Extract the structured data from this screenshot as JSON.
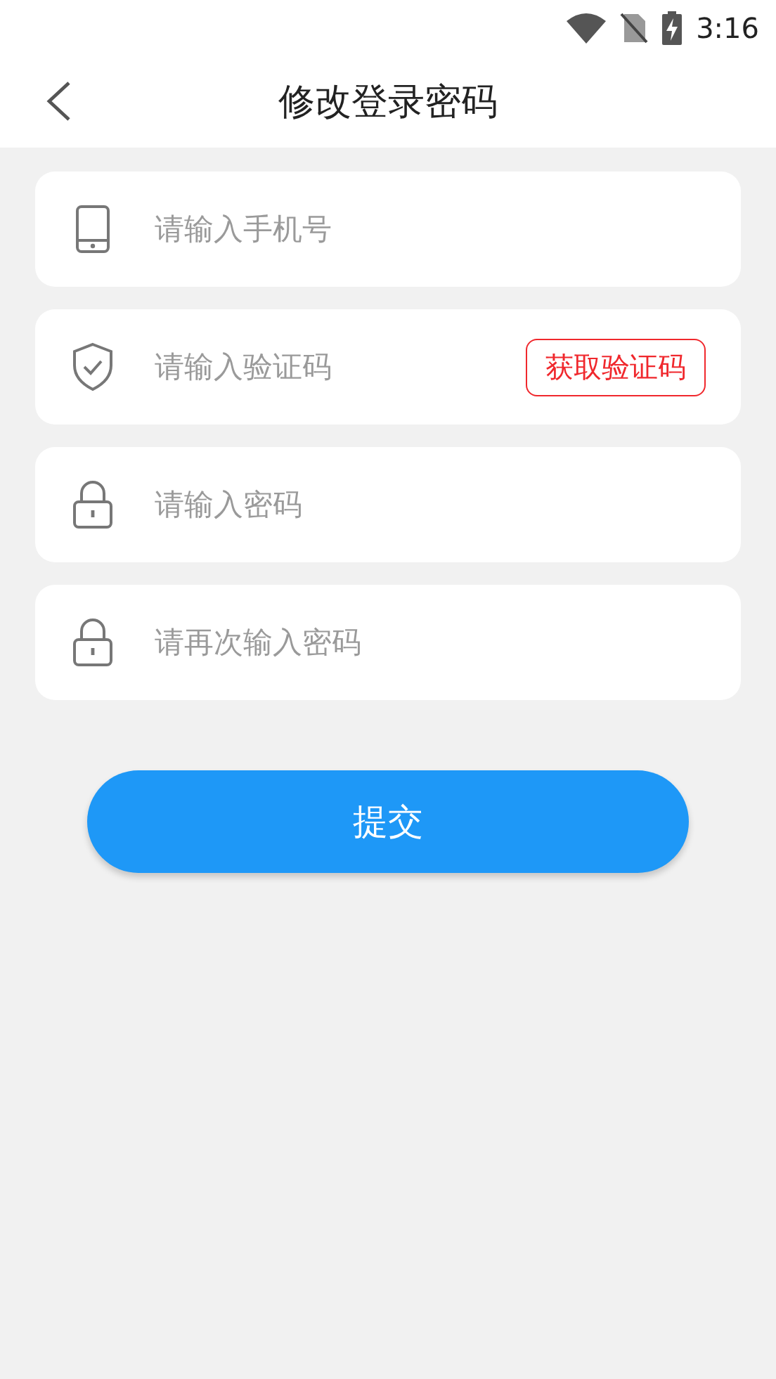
{
  "status_bar": {
    "time": "3:16"
  },
  "header": {
    "title": "修改登录密码"
  },
  "fields": [
    {
      "kind": "phone",
      "placeholder": "请输入手机号"
    },
    {
      "kind": "shield",
      "placeholder": "请输入验证码",
      "action": "获取验证码"
    },
    {
      "kind": "lock",
      "placeholder": "请输入密码"
    },
    {
      "kind": "lock",
      "placeholder": "请再次输入密码"
    }
  ],
  "submit": "提交"
}
